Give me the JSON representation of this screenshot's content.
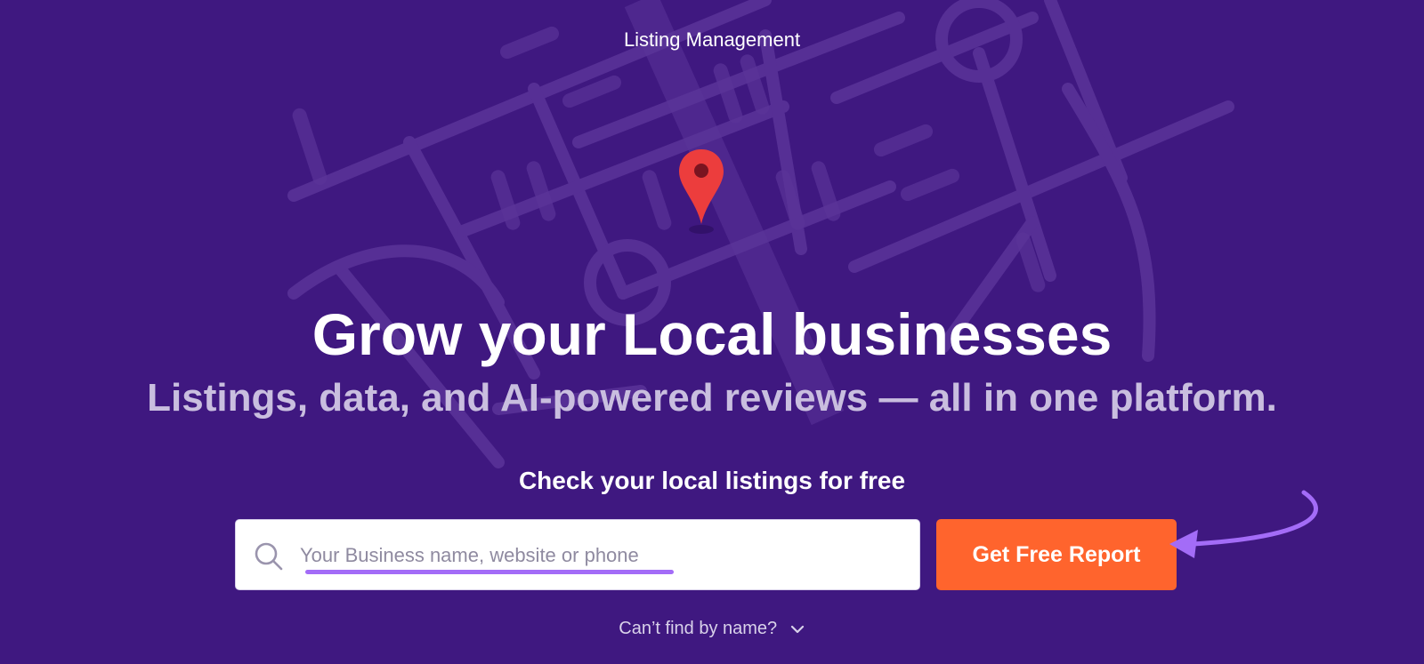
{
  "page": {
    "top_label": "Listing Management",
    "headline": "Grow your Local businesses",
    "subheadline": "Listings, data, and AI-powered reviews — all in one platform.",
    "check_label": "Check your local listings for free"
  },
  "search": {
    "placeholder": "Your Business name, website or phone",
    "value": ""
  },
  "actions": {
    "get_report_label": "Get Free Report",
    "cant_find_label": "Can’t find by name?"
  },
  "icons": {
    "search": "search-icon",
    "pin": "map-pin-icon",
    "chevron": "chevron-down-icon",
    "arrow": "annotation-arrow-icon"
  },
  "colors": {
    "background": "#3f1880",
    "accent_button": "#ff642d",
    "annotation": "#a36cf7",
    "pin": "#ec3d3d"
  }
}
